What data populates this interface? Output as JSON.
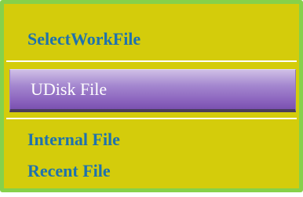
{
  "panel": {
    "title": "SelectWorkFile",
    "items": [
      {
        "label": "UDisk File",
        "selected": true
      },
      {
        "label": "Internal File",
        "selected": false
      },
      {
        "label": "Recent File",
        "selected": false
      }
    ]
  },
  "colors": {
    "panel_background": "#d4cc0b",
    "panel_border": "#86d14a",
    "text_accent": "#1f72ad",
    "selection_highlight": "#8a62bd",
    "selection_text": "#ffffff"
  }
}
